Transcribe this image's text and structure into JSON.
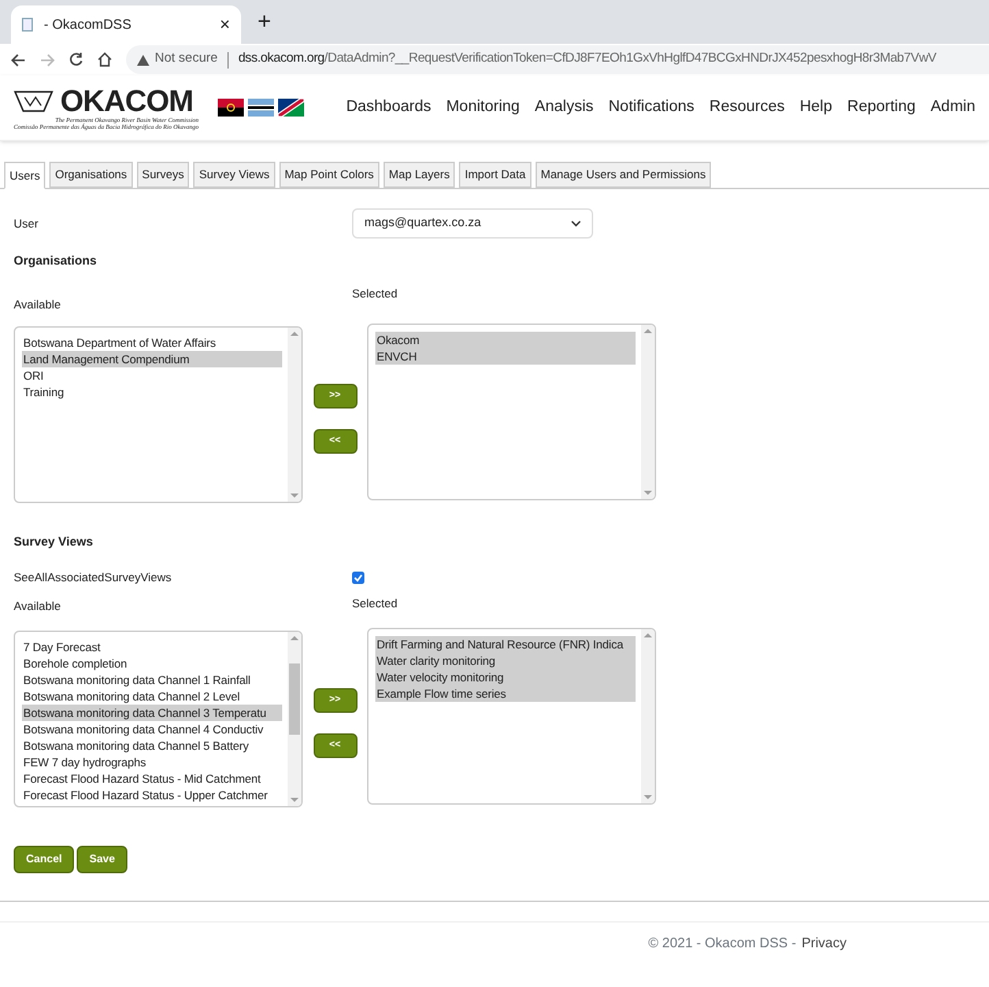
{
  "browser": {
    "tab_title": "- OkacomDSS",
    "tab_close": "×",
    "new_tab": "+",
    "security": "Not secure",
    "url_host": "dss.okacom.org",
    "url_path": "/DataAdmin?__RequestVerificationToken=CfDJ8F7EOh1GxVhHglfD47BCGxHNDrJX452pesxhogH8r3Mab7VwV"
  },
  "header": {
    "logo": "OKACOM",
    "logo_sub": [
      "The Permanent Okavango River Basin Water Commission",
      "Comissão Permanente das Águas da Bacia Hidrográfica do Rio Okavango"
    ],
    "nav": [
      "Dashboards",
      "Monitoring",
      "Analysis",
      "Notifications",
      "Resources",
      "Help",
      "Reporting",
      "Admin"
    ]
  },
  "tabs": [
    {
      "label": "Users",
      "selected": true
    },
    {
      "label": "Organisations",
      "selected": false
    },
    {
      "label": "Surveys",
      "selected": false
    },
    {
      "label": "Survey Views",
      "selected": false
    },
    {
      "label": "Map Point Colors",
      "selected": false
    },
    {
      "label": "Map Layers",
      "selected": false
    },
    {
      "label": "Import Data",
      "selected": false
    },
    {
      "label": "Manage Users and Permissions",
      "selected": false
    }
  ],
  "user": {
    "label": "User",
    "value": "mags@quartex.co.za"
  },
  "organisations": {
    "heading": "Organisations",
    "available_label": "Available",
    "selected_label": "Selected",
    "available": [
      {
        "label": "Botswana Department of Water Affairs",
        "selected": false
      },
      {
        "label": "Land Management Compendium",
        "selected": true
      },
      {
        "label": "ORI",
        "selected": false
      },
      {
        "label": "Training",
        "selected": false
      }
    ],
    "chosen": [
      {
        "label": "Okacom",
        "selected": true
      },
      {
        "label": "ENVCH",
        "selected": true
      }
    ],
    "add": ">>",
    "remove": "<<"
  },
  "survey_views": {
    "heading": "Survey Views",
    "see_all_label": "SeeAllAssociatedSurveyViews",
    "see_all_checked": true,
    "available_label": "Available",
    "selected_label": "Selected",
    "available": [
      {
        "label": "7 Day Forecast",
        "selected": false
      },
      {
        "label": "Borehole completion",
        "selected": false
      },
      {
        "label": "Botswana monitoring data Channel 1 Rainfall",
        "selected": false
      },
      {
        "label": "Botswana monitoring data Channel 2 Level",
        "selected": false
      },
      {
        "label": "Botswana monitoring data Channel 3 Temperatu",
        "selected": true
      },
      {
        "label": "Botswana monitoring data Channel 4 Conductiv",
        "selected": false
      },
      {
        "label": "Botswana monitoring data Channel 5 Battery",
        "selected": false
      },
      {
        "label": "FEW 7 day hydrographs",
        "selected": false
      },
      {
        "label": "Forecast Flood Hazard Status - Mid Catchment",
        "selected": false
      },
      {
        "label": "Forecast Flood Hazard Status - Upper Catchmer",
        "selected": false
      }
    ],
    "chosen": [
      {
        "label": "Drift Farming and Natural Resource (FNR) Indica",
        "selected": true
      },
      {
        "label": "Water clarity monitoring",
        "selected": true
      },
      {
        "label": "Water velocity monitoring",
        "selected": true
      },
      {
        "label": "Example Flow time series",
        "selected": true
      }
    ],
    "add": ">>",
    "remove": "<<"
  },
  "buttons": [
    "Cancel",
    "Save"
  ],
  "footer": {
    "text": "© 2021 - Okacom DSS -",
    "link": "Privacy"
  }
}
